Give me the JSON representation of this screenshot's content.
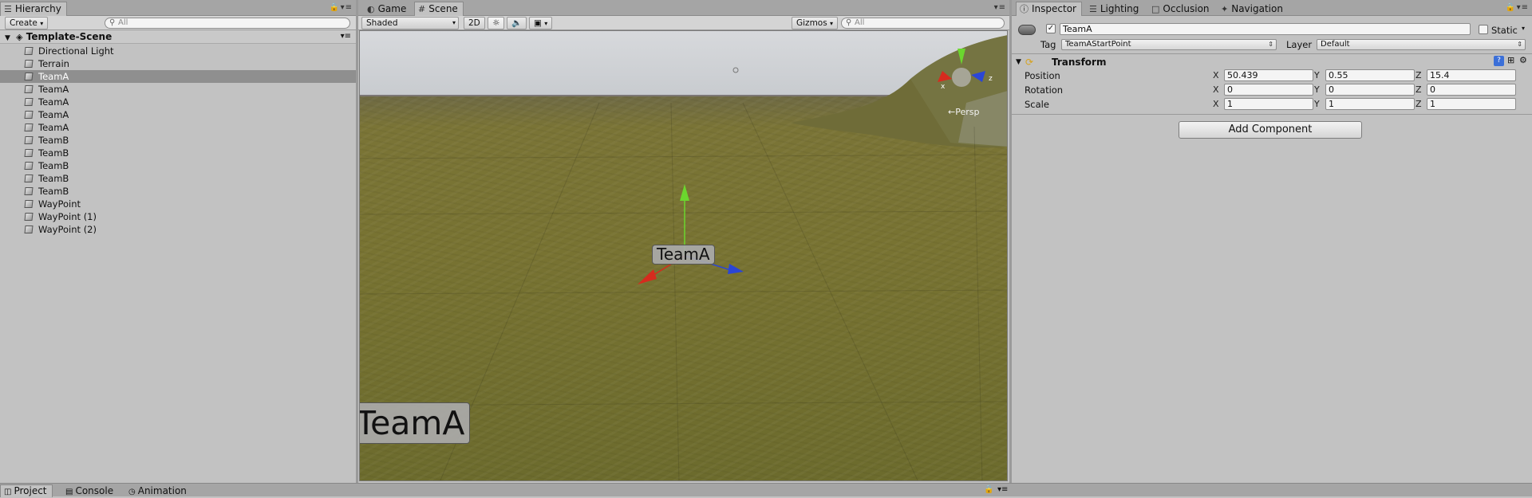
{
  "hierarchy": {
    "tab_label": "Hierarchy",
    "create_label": "Create",
    "search_placeholder": "All",
    "scene_name": "Template-Scene",
    "items": [
      {
        "label": "Directional Light",
        "selected": false
      },
      {
        "label": "Terrain",
        "selected": false
      },
      {
        "label": "TeamA",
        "selected": true
      },
      {
        "label": "TeamA",
        "selected": false
      },
      {
        "label": "TeamA",
        "selected": false
      },
      {
        "label": "TeamA",
        "selected": false
      },
      {
        "label": "TeamA",
        "selected": false
      },
      {
        "label": "TeamB",
        "selected": false
      },
      {
        "label": "TeamB",
        "selected": false
      },
      {
        "label": "TeamB",
        "selected": false
      },
      {
        "label": "TeamB",
        "selected": false
      },
      {
        "label": "TeamB",
        "selected": false
      },
      {
        "label": "WayPoint",
        "selected": false
      },
      {
        "label": "WayPoint (1)",
        "selected": false
      },
      {
        "label": "WayPoint (2)",
        "selected": false
      }
    ]
  },
  "scene": {
    "tabs": {
      "game": "Game",
      "scene": "Scene"
    },
    "shading_mode": "Shaded",
    "mode_2d": "2D",
    "gizmos_label": "Gizmos",
    "search_placeholder": "All",
    "persp_label": "←Persp",
    "object_label": "TeamA",
    "big_label": "TeamA",
    "axis_x": "x",
    "axis_z": "z"
  },
  "inspector": {
    "tabs": {
      "inspector": "Inspector",
      "lighting": "Lighting",
      "occlusion": "Occlusion",
      "navigation": "Navigation"
    },
    "object_name": "TeamA",
    "active": true,
    "static_label": "Static",
    "tag_label": "Tag",
    "tag_value": "TeamAStartPoint",
    "layer_label": "Layer",
    "layer_value": "Default",
    "component_title": "Transform",
    "rows": [
      {
        "label": "Position",
        "x": "50.439",
        "y": "0.55",
        "z": "15.4"
      },
      {
        "label": "Rotation",
        "x": "0",
        "y": "0",
        "z": "0"
      },
      {
        "label": "Scale",
        "x": "1",
        "y": "1",
        "z": "1"
      }
    ],
    "axis_labels": {
      "x": "X",
      "y": "Y",
      "z": "Z"
    },
    "add_component": "Add Component"
  },
  "bottom": {
    "tabs": {
      "project": "Project",
      "console": "Console",
      "animation": "Animation"
    }
  },
  "colors": {
    "panel_bg": "#c2c2c2",
    "selection": "#8f8f8f",
    "gizmo_x": "#d62b1e",
    "gizmo_y": "#6bd62e",
    "gizmo_z": "#2b46d6"
  }
}
